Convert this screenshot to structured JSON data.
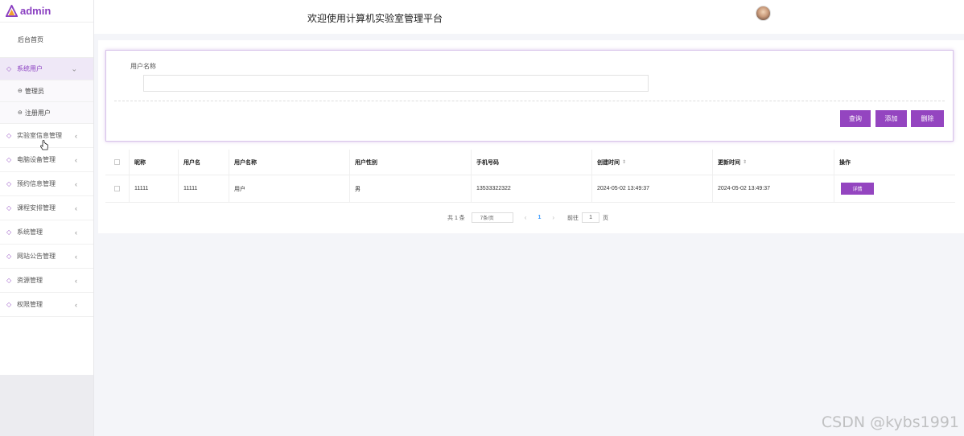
{
  "brand": {
    "name": "admin",
    "accent": "#9445c0"
  },
  "header": {
    "title": "欢迎使用计算机实验室管理平台"
  },
  "sidebar": {
    "home": "后台首页",
    "items": [
      {
        "label": "系统用户",
        "icon": "tag-icon",
        "expanded": true
      },
      {
        "label": "实验室信息管理",
        "icon": "tag-icon"
      },
      {
        "label": "电脑设备管理",
        "icon": "tag-icon"
      },
      {
        "label": "预约信息管理",
        "icon": "tag-icon"
      },
      {
        "label": "课程安排管理",
        "icon": "tag-icon"
      },
      {
        "label": "系统管理",
        "icon": "tag-icon"
      },
      {
        "label": "网站公告管理",
        "icon": "tag-icon"
      },
      {
        "label": "资源管理",
        "icon": "tag-icon"
      },
      {
        "label": "权限管理",
        "icon": "tag-icon"
      }
    ],
    "sub_items": [
      "管理员",
      "注册用户"
    ]
  },
  "search": {
    "label": "用户名称",
    "value": "",
    "placeholder": ""
  },
  "buttons": {
    "query": "查询",
    "add": "添加",
    "delete": "删除"
  },
  "table": {
    "headers": [
      "昵称",
      "用户名",
      "用户名称",
      "用户性别",
      "手机号码",
      "创建时间",
      "更新时间",
      "操作"
    ],
    "rows": [
      {
        "nickname": "11111",
        "username": "11111",
        "user_name": "用户",
        "gender": "男",
        "phone": "13533322322",
        "created": "2024-05-02 13:49:37",
        "updated": "2024-05-02 13:49:37",
        "action": "详情"
      }
    ]
  },
  "pagination": {
    "total": "共 1 条",
    "page_size": "7条/页",
    "current_page": "1",
    "jump_label": "前往",
    "jump_value": "1",
    "jump_suffix": "页"
  },
  "watermark": "CSDN @kybs1991"
}
